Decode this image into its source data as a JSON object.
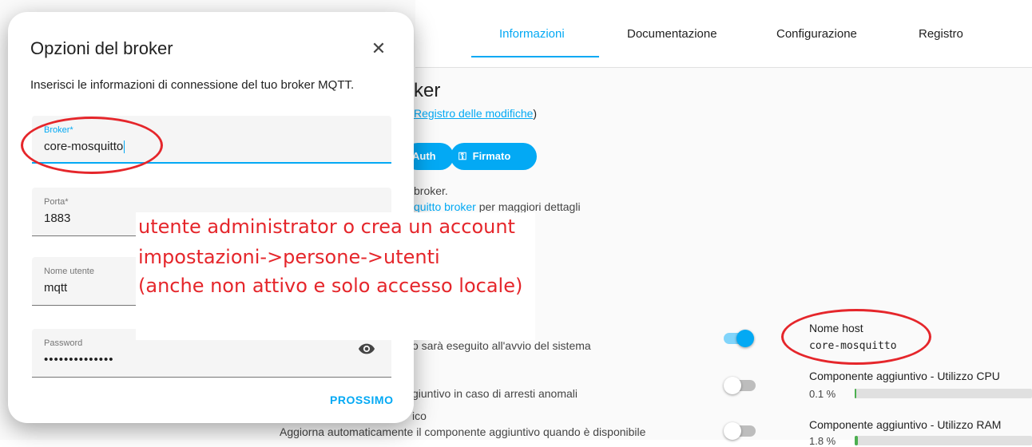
{
  "tabs": [
    {
      "label": "Informazioni",
      "active": true
    },
    {
      "label": "Documentazione",
      "active": false
    },
    {
      "label": "Configurazione",
      "active": false
    },
    {
      "label": "Registro",
      "active": false
    }
  ],
  "addon": {
    "title_fragment": "ker",
    "changelog_link": "Registro delle modifiche",
    "changelog_suffix": ")",
    "badges": [
      {
        "label": "Auth"
      },
      {
        "label": "Firmato"
      }
    ],
    "description_line1": "broker.",
    "description_link": "quitto broker",
    "description_line2_suffix": " per maggiori dettagli"
  },
  "options": [
    {
      "text": "o sarà eseguito all'avvio del sistema",
      "enabled": true
    },
    {
      "text": "giuntivo in caso di arresti anomali",
      "enabled": false
    },
    {
      "text": "ico",
      "enabled": false
    },
    {
      "text": "Aggiorna automaticamente il componente aggiuntivo quando è disponibile",
      "enabled": false
    }
  ],
  "info": {
    "hostname_label": "Nome host",
    "hostname_value": "core-mosquitto",
    "cpu_label": "Componente aggiuntivo - Utilizzo CPU",
    "cpu_value": "0.1 %",
    "cpu_fraction": 0.001,
    "ram_label": "Componente aggiuntivo - Utilizzo RAM",
    "ram_value": "1.8 %",
    "ram_fraction": 0.018
  },
  "dialog": {
    "title": "Opzioni del broker",
    "description": "Inserisci le informazioni di connessione del tuo broker MQTT.",
    "fields": {
      "broker": {
        "label": "Broker*",
        "value": "core-mosquitto"
      },
      "port": {
        "label": "Porta*",
        "value": "1883"
      },
      "username": {
        "label": "Nome utente",
        "value": "mqtt"
      },
      "password": {
        "label": "Password",
        "value": "••••••••••••••"
      }
    },
    "next_label": "PROSSIMO"
  },
  "annotation": {
    "line1": "utente administrator o crea un account",
    "line2": "impostazioni->persone->utenti",
    "line3": "(anche non attivo e solo accesso locale)"
  },
  "colors": {
    "accent": "#03a9f4",
    "annotation_red": "#e5262b"
  }
}
